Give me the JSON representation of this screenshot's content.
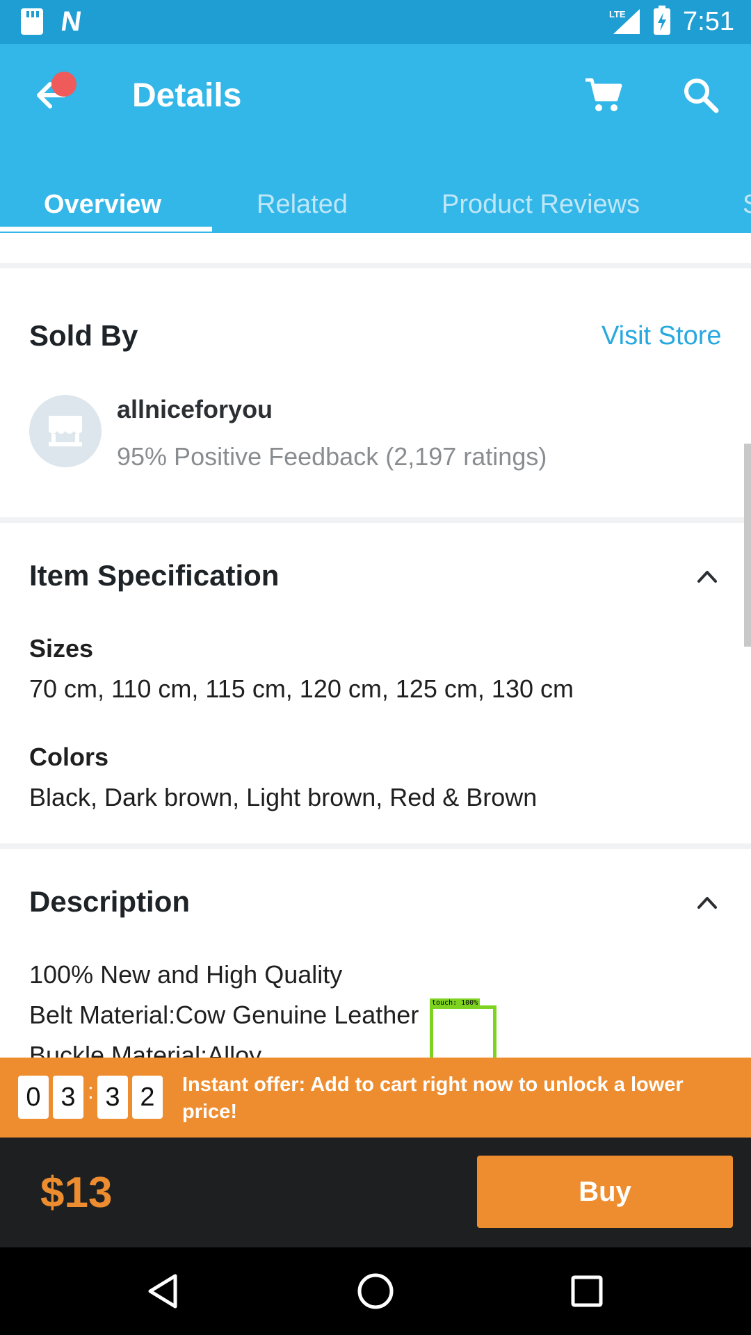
{
  "status_bar": {
    "network": "LTE",
    "time": "7:51",
    "icons": [
      "sd-card-icon",
      "n-notification-icon",
      "signal-icon",
      "battery-charging-icon"
    ]
  },
  "app_bar": {
    "title": "Details",
    "back_icon": "arrow-left-icon",
    "cart_icon": "cart-icon",
    "search_icon": "search-icon",
    "color": "#33b6e8"
  },
  "tabs": [
    {
      "label": "Overview",
      "active": true
    },
    {
      "label": "Related",
      "active": false
    },
    {
      "label": "Product Reviews",
      "active": false
    },
    {
      "label": "S",
      "active": false
    }
  ],
  "sold_by": {
    "heading": "Sold By",
    "visit_store": "Visit Store",
    "seller_name": "allniceforyou",
    "feedback": "95% Positive Feedback (2,197 ratings)"
  },
  "item_spec": {
    "heading": "Item Specification",
    "sizes_label": "Sizes",
    "sizes_value": "70 cm, 110 cm, 115 cm, 120 cm, 125 cm, 130 cm",
    "colors_label": "Colors",
    "colors_value": "Black, Dark brown, Light brown, Red & Brown"
  },
  "description": {
    "heading": "Description",
    "lines": [
      "100% New and High Quality",
      "Belt Material:Cow Genuine Leather",
      "Buckle Material:Alloy"
    ]
  },
  "offer": {
    "digits": [
      "0",
      "3",
      "3",
      "2"
    ],
    "separator": ":",
    "text": "Instant offer: Add to cart right now to unlock a lower price!",
    "color": "#ee8d2f"
  },
  "purchase": {
    "price": "$13",
    "buy_label": "Buy"
  },
  "touch_overlay": {
    "label": "touch: 100%"
  }
}
